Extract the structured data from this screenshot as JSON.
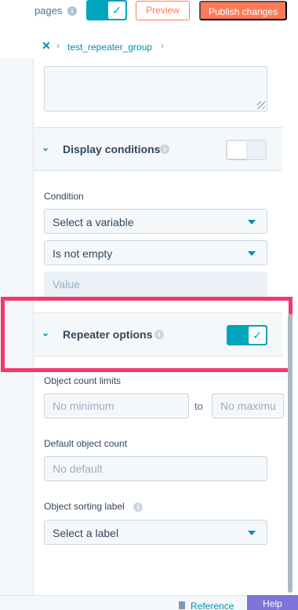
{
  "topbar": {
    "pages_label": "pages",
    "preview_label": "Preview",
    "publish_label": "Publish changes"
  },
  "breadcrumb": {
    "module": "test_repeater_group"
  },
  "display_conditions": {
    "title": "Display conditions",
    "enabled": false,
    "condition_label": "Condition",
    "variable_select": "Select a variable",
    "operator_select": "Is not empty",
    "value_placeholder": "Value"
  },
  "repeater_options": {
    "title": "Repeater options",
    "enabled": true,
    "object_count_limits_label": "Object count limits",
    "min_placeholder": "No minimum",
    "to_label": "to",
    "max_placeholder": "No maximum",
    "default_count_label": "Default object count",
    "default_placeholder": "No default",
    "sorting_label": "Object sorting label",
    "sorting_select": "Select a label"
  },
  "footer": {
    "reference_label": "Reference",
    "help_label": "Help"
  },
  "colors": {
    "accent": "#00a4bd",
    "cta": "#ff7a59",
    "highlight": "#f2386c",
    "help": "#7f74d8"
  }
}
